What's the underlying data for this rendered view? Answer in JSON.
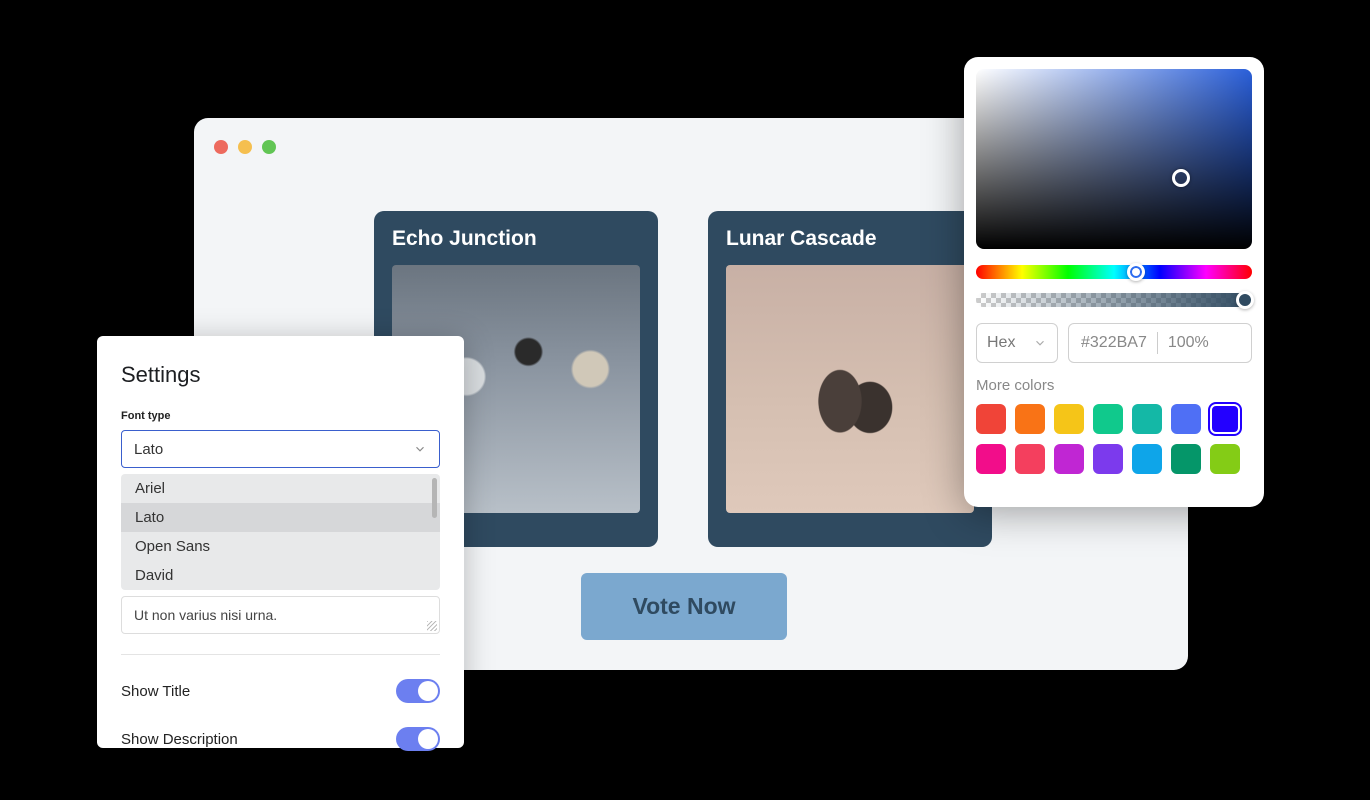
{
  "window": {
    "cards": [
      {
        "title": "Echo Junction"
      },
      {
        "title": "Lunar Cascade"
      }
    ],
    "vote_label": "Vote Now"
  },
  "settings": {
    "title": "Settings",
    "font_type_label": "Font type",
    "font_selected": "Lato",
    "font_options": [
      "Ariel",
      "Lato",
      "Open Sans",
      "David"
    ],
    "description_value": "Ut non varius nisi urna.",
    "toggles": {
      "show_title_label": "Show Title",
      "show_title_on": true,
      "show_description_label": "Show Description",
      "show_description_on": true
    }
  },
  "color_picker": {
    "format_label": "Hex",
    "hex_value": "#322BA7",
    "opacity_value": "100%",
    "more_colors_label": "More colors",
    "swatches_row1": [
      "#F04438",
      "#F97316",
      "#F5C518",
      "#10C98C",
      "#14B8A6",
      "#4F6FF5",
      "#2300FF"
    ],
    "swatches_row2": [
      "#F20D8A",
      "#F43F5E",
      "#C026D3",
      "#7C3AED",
      "#0EA5E9",
      "#059669",
      "#84CC16"
    ],
    "selected_swatch": "#2300FF"
  }
}
